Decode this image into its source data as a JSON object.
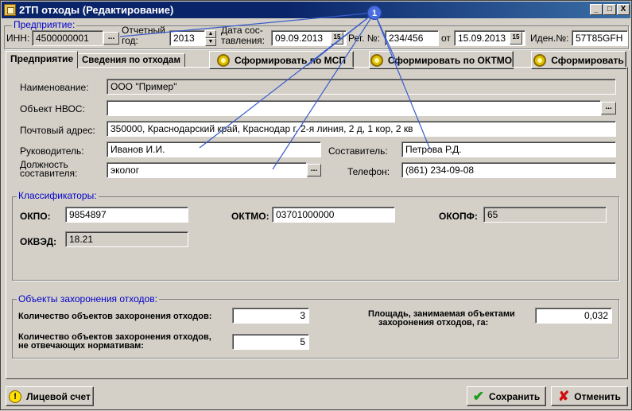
{
  "window": {
    "title": "2ТП отходы (Редактирование)",
    "controls": [
      "_",
      "□",
      "X"
    ]
  },
  "header": {
    "group_label": "Предприятие:",
    "inn_label": "ИНН:",
    "inn_value": "4500000001",
    "ellipsis": "...",
    "year_label_1": "Отчетный",
    "year_label_2": "год:",
    "year_value": "2013",
    "date_label_1": "Дата сос-",
    "date_label_2": "тавления:",
    "date_value": "09.09.2013",
    "calendar_glyph": "15",
    "reg_label": "Рег. №:",
    "reg_value": "234/456",
    "from_label": "от",
    "from_value": "15.09.2013",
    "iden_label": "Иден.№:",
    "iden_value": "57T85GFH"
  },
  "tabs": [
    {
      "label": "Предприятие"
    },
    {
      "label": "Сведения по отходам"
    }
  ],
  "actions": {
    "form_msp": "Сформировать по МСП",
    "form_oktmo": "Сформировать по ОКТМО",
    "form": "Сформировать"
  },
  "enterprise": {
    "name_label": "Наименование:",
    "name_value": "ООО \"Пример\"",
    "nvos_label": "Объект НВОС:",
    "nvos_value": "",
    "address_label": "Почтовый адрес:",
    "address_value": "350000, Краснодарский край, Краснодар г, 2-я линия, 2 д, 1 кор, 2 кв",
    "head_label": "Руководитель:",
    "head_value": "Иванов И.И.",
    "author_label": "Составитель:",
    "author_value": "Петрова Р.Д.",
    "position_label_1": "Должность",
    "position_label_2": "составителя:",
    "position_value": "эколог",
    "phone_label": "Телефон:",
    "phone_value": "(861) 234-09-08"
  },
  "classifiers": {
    "group_label": "Классификаторы:",
    "okpo_label": "ОКПО:",
    "okpo_value": "9854897",
    "oktmo_label": "ОКТМО:",
    "oktmo_value": "03701000000",
    "okopf_label": "ОКОПФ:",
    "okopf_value": "65",
    "okved_label": "ОКВЭД:",
    "okved_value": "18.21"
  },
  "burial": {
    "group_label": "Объекты захоронения отходов:",
    "count_label": "Количество объектов захоронения отходов:",
    "count_value": "3",
    "noncompliant_label_1": "Количество объектов захоронения отходов,",
    "noncompliant_label_2": "не отвечающих нормативам:",
    "noncompliant_value": "5",
    "area_label_1": "Площадь, занимаемая объектами",
    "area_label_2": "захоронения отходов, га:",
    "area_value": "0,032"
  },
  "footer": {
    "account_button": "Лицевой счет",
    "save_button": "Сохранить",
    "cancel_button": "Отменить"
  },
  "annotation": {
    "marker": "1"
  }
}
